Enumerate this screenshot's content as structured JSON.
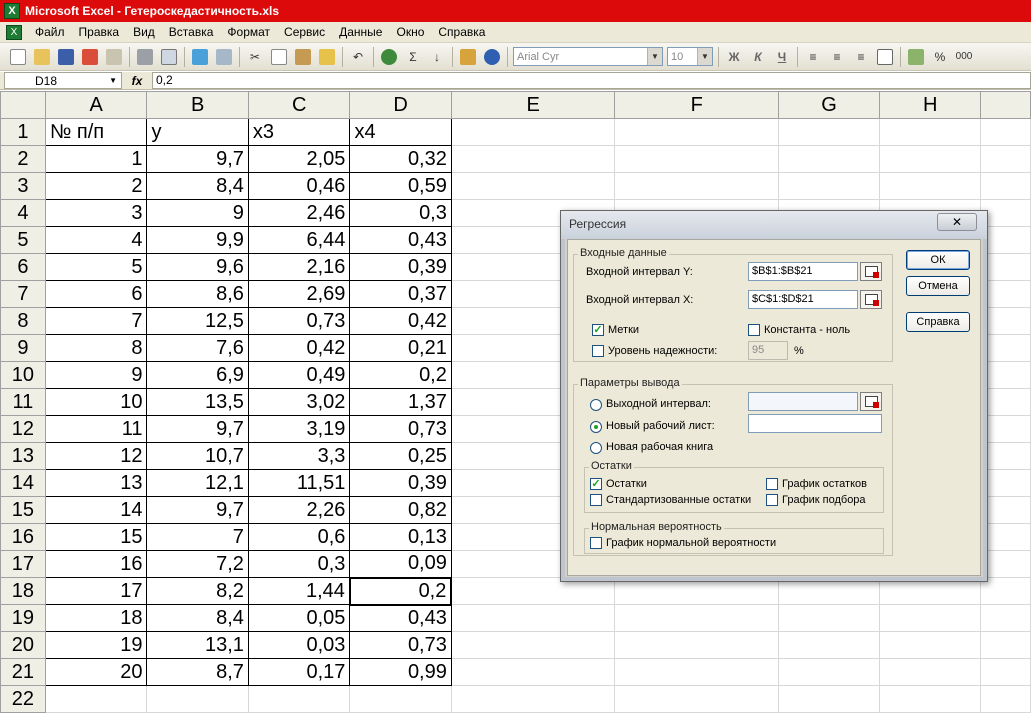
{
  "window": {
    "title": "Microsoft Excel - Гетероскедастичность.xls",
    "app_icon": "X"
  },
  "menu": [
    "Файл",
    "Правка",
    "Вид",
    "Вставка",
    "Формат",
    "Сервис",
    "Данные",
    "Окно",
    "Справка"
  ],
  "toolbar": {
    "font_name": "Arial Cyr",
    "font_size": "10",
    "bold": "Ж",
    "italic": "К",
    "underline": "Ч",
    "percent": "%",
    "thousands": "000",
    "sigma": "Σ"
  },
  "formula_bar": {
    "cell_ref": "D18",
    "fx": "fx",
    "value": "0,2"
  },
  "columns": [
    "A",
    "B",
    "C",
    "D",
    "E",
    "F",
    "G",
    "H"
  ],
  "rows": [
    [
      "№ п/п",
      "y",
      "x3",
      "x4"
    ],
    [
      "1",
      "9,7",
      "2,05",
      "0,32"
    ],
    [
      "2",
      "8,4",
      "0,46",
      "0,59"
    ],
    [
      "3",
      "9",
      "2,46",
      "0,3"
    ],
    [
      "4",
      "9,9",
      "6,44",
      "0,43"
    ],
    [
      "5",
      "9,6",
      "2,16",
      "0,39"
    ],
    [
      "6",
      "8,6",
      "2,69",
      "0,37"
    ],
    [
      "7",
      "12,5",
      "0,73",
      "0,42"
    ],
    [
      "8",
      "7,6",
      "0,42",
      "0,21"
    ],
    [
      "9",
      "6,9",
      "0,49",
      "0,2"
    ],
    [
      "10",
      "13,5",
      "3,02",
      "1,37"
    ],
    [
      "11",
      "9,7",
      "3,19",
      "0,73"
    ],
    [
      "12",
      "10,7",
      "3,3",
      "0,25"
    ],
    [
      "13",
      "12,1",
      "11,51",
      "0,39"
    ],
    [
      "14",
      "9,7",
      "2,26",
      "0,82"
    ],
    [
      "15",
      "7",
      "0,6",
      "0,13"
    ],
    [
      "16",
      "7,2",
      "0,3",
      "0,09"
    ],
    [
      "17",
      "8,2",
      "1,44",
      "0,2"
    ],
    [
      "18",
      "8,4",
      "0,05",
      "0,43"
    ],
    [
      "19",
      "13,1",
      "0,03",
      "0,73"
    ],
    [
      "20",
      "8,7",
      "0,17",
      "0,99"
    ],
    [
      "",
      "",
      "",
      ""
    ]
  ],
  "dialog": {
    "title": "Регрессия",
    "close": "✕",
    "input_group": "Входные данные",
    "y_label": "Входной интервал Y:",
    "y_value": "$B$1:$B$21",
    "x_label": "Входной интервал X:",
    "x_value": "$C$1:$D$21",
    "labels": "Метки",
    "constant_zero": "Константа - ноль",
    "confidence": "Уровень надежности:",
    "confidence_value": "95",
    "percent": "%",
    "output_group": "Параметры вывода",
    "output_range": "Выходной интервал:",
    "new_sheet": "Новый рабочий лист:",
    "new_book": "Новая рабочая книга",
    "residuals_group": "Остатки",
    "residuals": "Остатки",
    "residual_plot": "График остатков",
    "std_residuals": "Стандартизованные остатки",
    "fit_plot": "График подбора",
    "normal_group": "Нормальная вероятность",
    "normal_plot": "График нормальной вероятности",
    "ok": "ОК",
    "cancel": "Отмена",
    "help": "Справка"
  }
}
